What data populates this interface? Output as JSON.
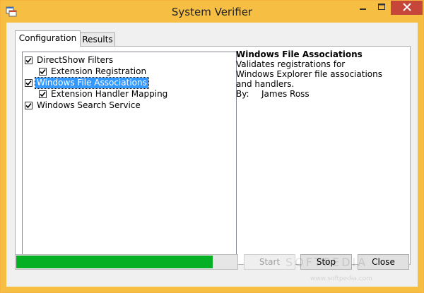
{
  "window": {
    "title": "System Verifier",
    "accent": "#f6bf44",
    "close_color": "#c7463a"
  },
  "tabs": [
    {
      "label": "Configuration",
      "selected": true
    },
    {
      "label": "Results",
      "selected": false
    }
  ],
  "tree": [
    {
      "label": "DirectShow Filters",
      "checked": true,
      "level": 0,
      "selected": false
    },
    {
      "label": "Extension Registration",
      "checked": true,
      "level": 1,
      "selected": false
    },
    {
      "label": "Windows File Associations",
      "checked": true,
      "level": 0,
      "selected": true
    },
    {
      "label": "Extension Handler Mapping",
      "checked": true,
      "level": 1,
      "selected": false
    },
    {
      "label": "Windows Search Service",
      "checked": true,
      "level": 0,
      "selected": false
    }
  ],
  "details": {
    "title": "Windows File Associations",
    "description": "Validates registrations for Windows Explorer file associations and handlers.",
    "by_label": "By:",
    "author": "James Ross"
  },
  "progress": {
    "value": 0.89,
    "color": "#06b025"
  },
  "buttons": {
    "start": {
      "label": "Start",
      "enabled": false
    },
    "stop": {
      "label": "Stop",
      "enabled": true
    },
    "close": {
      "label": "Close",
      "enabled": true
    }
  },
  "icons": [
    "app-icon",
    "minimize-icon",
    "maximize-icon",
    "close-icon",
    "checkmark-icon"
  ],
  "watermark": {
    "main": "SOFTPEDIA",
    "url": "www.softpedia.com"
  }
}
